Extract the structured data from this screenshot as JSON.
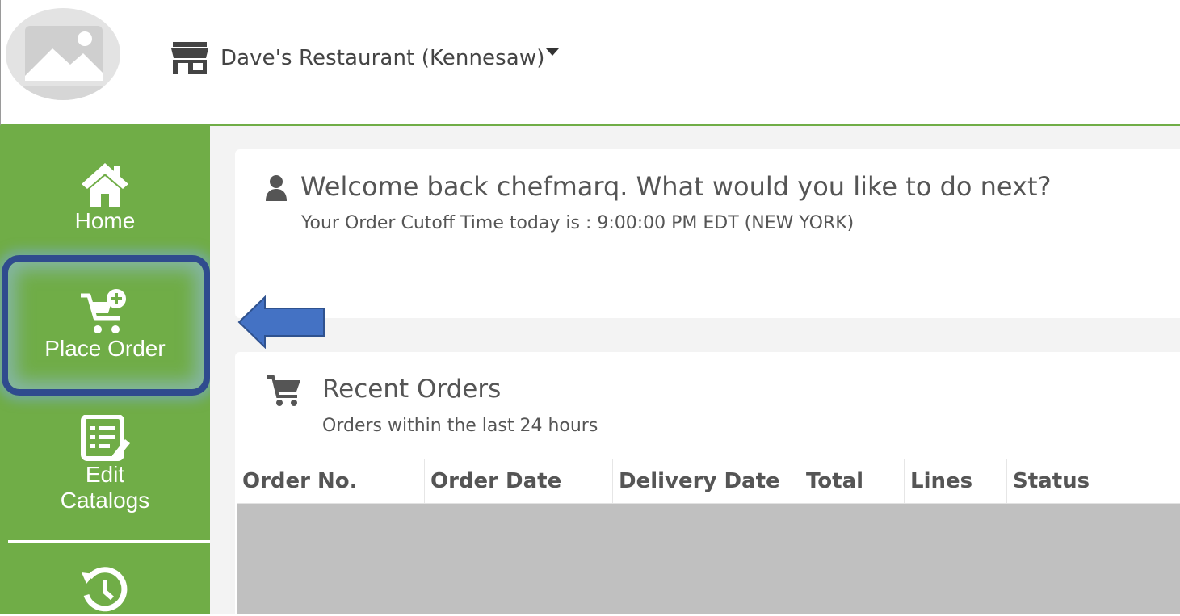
{
  "header": {
    "store_name": "Dave's Restaurant (Kennesaw)"
  },
  "sidebar": {
    "items": [
      {
        "label": "Home",
        "icon": "home-icon"
      },
      {
        "label": "Place Order",
        "icon": "cart-plus-icon"
      },
      {
        "label": "Edit Catalogs",
        "icon": "catalog-edit-icon"
      },
      {
        "label": "",
        "icon": "history-icon"
      }
    ]
  },
  "welcome": {
    "title": "Welcome back chefmarq. What would you like to do next?",
    "cutoff": "Your Order Cutoff Time today is : 9:00:00 PM EDT (NEW YORK)"
  },
  "recent_orders": {
    "title": "Recent Orders",
    "subtitle": "Orders within the last 24 hours",
    "columns": [
      "Order No.",
      "Order Date",
      "Delivery Date",
      "Total",
      "Lines",
      "Status"
    ],
    "rows": []
  },
  "colors": {
    "sidebar_green": "#70ad47",
    "highlight_border": "#2f4b8e",
    "arrow_blue": "#4472c4"
  }
}
